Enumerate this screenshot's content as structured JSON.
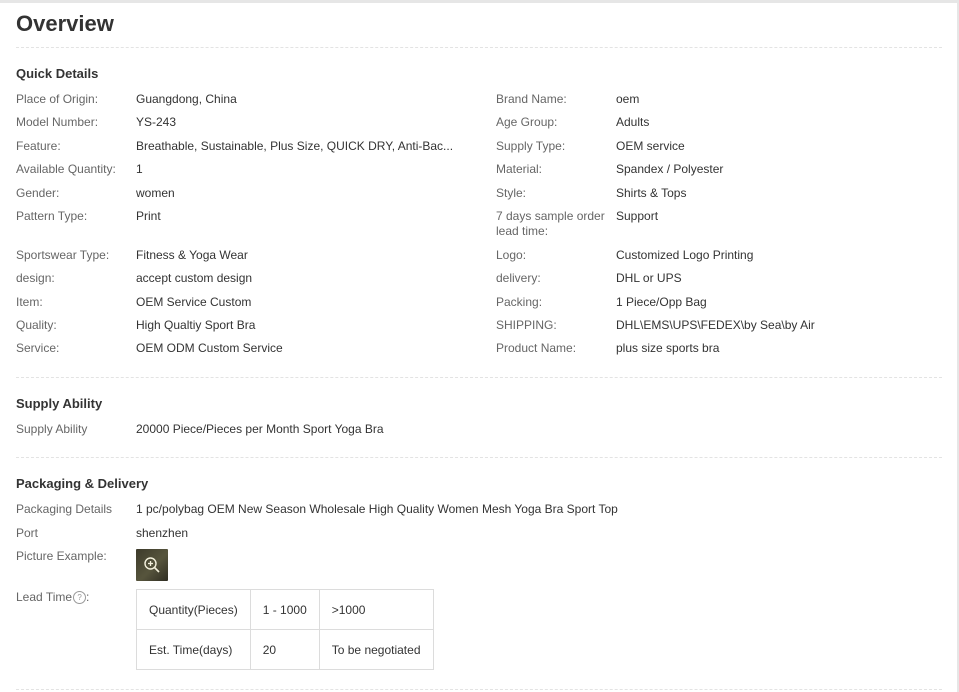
{
  "overview": {
    "title": "Overview"
  },
  "quick_details": {
    "heading": "Quick Details",
    "left": [
      {
        "label": "Place of Origin:",
        "value": "Guangdong, China"
      },
      {
        "label": "Model Number:",
        "value": "YS-243"
      },
      {
        "label": "Feature:",
        "value": "Breathable, Sustainable, Plus Size, QUICK DRY, Anti-Bac..."
      },
      {
        "label": "Available Quantity:",
        "value": "1"
      },
      {
        "label": "Gender:",
        "value": "women"
      },
      {
        "label": "Pattern Type:",
        "value": "Print"
      },
      {
        "label": "Sportswear Type:",
        "value": "Fitness & Yoga Wear"
      },
      {
        "label": "design:",
        "value": "accept custom design"
      },
      {
        "label": "Item:",
        "value": "OEM Service Custom"
      },
      {
        "label": "Quality:",
        "value": "High Qualtiy Sport Bra"
      },
      {
        "label": "Service:",
        "value": "OEM ODM Custom Service"
      }
    ],
    "right": [
      {
        "label": "Brand Name:",
        "value": "oem"
      },
      {
        "label": "Age Group:",
        "value": "Adults"
      },
      {
        "label": "Supply Type:",
        "value": "OEM service"
      },
      {
        "label": "Material:",
        "value": "Spandex / Polyester"
      },
      {
        "label": "Style:",
        "value": "Shirts & Tops"
      },
      {
        "label": "7 days sample order lead time:",
        "value": "Support"
      },
      {
        "label": "Logo:",
        "value": "Customized Logo Printing"
      },
      {
        "label": "delivery:",
        "value": "DHL or UPS"
      },
      {
        "label": "Packing:",
        "value": "1 Piece/Opp Bag"
      },
      {
        "label": "SHIPPING:",
        "value": "DHL\\EMS\\UPS\\FEDEX\\by Sea\\by Air"
      },
      {
        "label": "Product Name:",
        "value": "plus size sports bra"
      }
    ]
  },
  "supply_ability": {
    "heading": "Supply Ability",
    "label": "Supply Ability",
    "value": "20000 Piece/Pieces per Month Sport Yoga Bra"
  },
  "packaging_delivery": {
    "heading": "Packaging & Delivery",
    "details_label": "Packaging Details",
    "details_value": "1 pc/polybag OEM New Season Wholesale High Quality Women Mesh Yoga Bra Sport Top",
    "port_label": "Port",
    "port_value": "shenzhen",
    "picture_label": "Picture Example:",
    "picture_icon": "zoom-in-icon",
    "lead_time_label": "Lead Time",
    "lead_time_help": "?",
    "lead_time_table": {
      "header": [
        "Quantity(Pieces)",
        "1 - 1000",
        ">1000"
      ],
      "row": [
        "Est. Time(days)",
        "20",
        "To be negotiated"
      ]
    }
  }
}
